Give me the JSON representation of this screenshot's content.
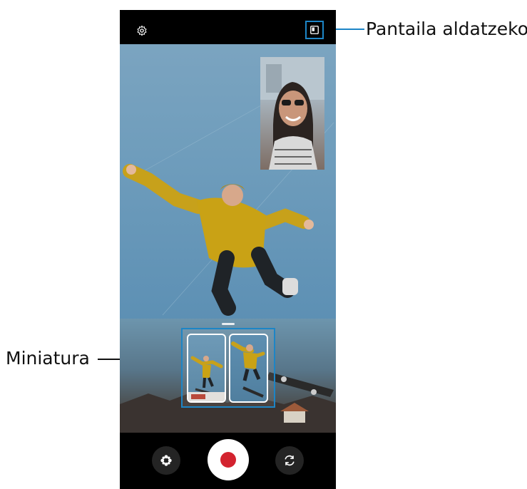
{
  "callouts": {
    "pantaila": "Pantaila aldatzeko",
    "miniatura": "Miniatura"
  },
  "icons": {
    "settings": "gear-icon",
    "screen_switch": "picture-in-picture-icon",
    "effects": "flower-effect-icon",
    "record": "record-icon",
    "switch_camera": "rotate-camera-icon"
  },
  "colors": {
    "accent": "#1d85c6",
    "record": "#d3232f"
  }
}
